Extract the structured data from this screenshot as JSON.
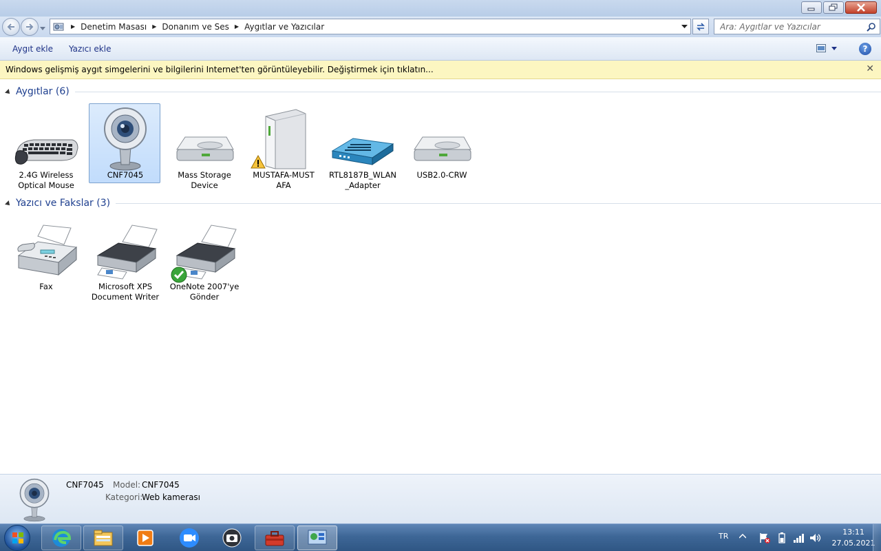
{
  "window": {
    "controls": [
      "minimize",
      "maximize",
      "close"
    ]
  },
  "address": {
    "breadcrumbs": [
      "Denetim Masası",
      "Donanım ve Ses",
      "Aygıtlar ve Yazıcılar"
    ],
    "search_placeholder": "Ara: Aygıtlar ve Yazıcılar"
  },
  "commands": {
    "add_device": "Aygıt ekle",
    "add_printer": "Yazıcı ekle"
  },
  "infobar": {
    "message": "Windows gelişmiş aygıt simgelerini ve bilgilerini Internet'ten görüntüleyebilir. Değiştirmek için tıklatın...",
    "close": "✕"
  },
  "groups": {
    "devices": {
      "title": "Aygıtlar (6)",
      "items": [
        {
          "label": "2.4G Wireless\nOptical Mouse",
          "icon": "keyboard-mouse-icon"
        },
        {
          "label": "CNF7045",
          "icon": "webcam-icon",
          "selected": true
        },
        {
          "label": "Mass Storage\nDevice",
          "icon": "hard-drive-icon"
        },
        {
          "label": "MUSTAFA-MUST\nAFA",
          "icon": "computer-tower-icon",
          "badge": "warning"
        },
        {
          "label": "RTL8187B_WLAN\n_Adapter",
          "icon": "network-adapter-icon"
        },
        {
          "label": "USB2.0-CRW",
          "icon": "hard-drive-icon"
        }
      ]
    },
    "printers": {
      "title": "Yazıcı ve Fakslar (3)",
      "items": [
        {
          "label": "Fax",
          "icon": "fax-icon"
        },
        {
          "label": "Microsoft XPS\nDocument Writer",
          "icon": "printer-icon"
        },
        {
          "label": "OneNote 2007'ye\nGönder",
          "icon": "printer-icon",
          "badge": "default-check"
        }
      ]
    }
  },
  "details": {
    "device_name": "CNF7045",
    "model_key": "Model:",
    "model_value": "CNF7045",
    "category_key": "Kategori:",
    "category_value": "Web kamerası"
  },
  "taskbar": {
    "apps": [
      "edge-icon",
      "file-explorer-icon",
      "media-player-icon",
      "zoom-icon",
      "camera-icon",
      "toolbox-icon",
      "control-panel-icon"
    ],
    "tray": {
      "language": "TR",
      "time": "13:11",
      "date": "27.05.2021"
    }
  },
  "colors": {
    "accent": "#1e3f8f",
    "infobar": "#fcf6c1",
    "selection": "#c1dcfc"
  }
}
